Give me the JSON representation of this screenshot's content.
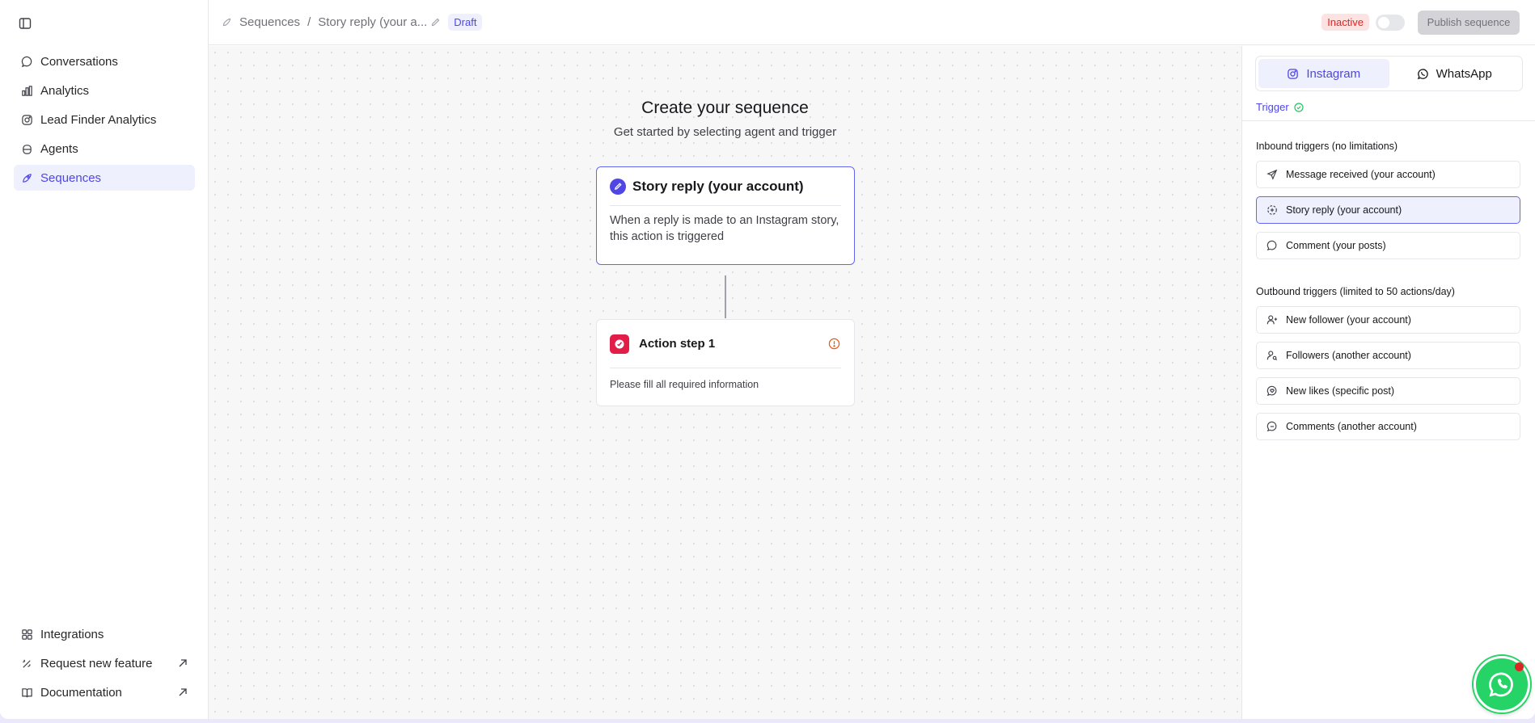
{
  "sidebar": {
    "toggle_icon": "sidebar-toggle-icon",
    "items": [
      {
        "label": "Conversations",
        "icon": "chat-icon"
      },
      {
        "label": "Analytics",
        "icon": "bar-chart-icon"
      },
      {
        "label": "Lead Finder Analytics",
        "icon": "instagram-icon"
      },
      {
        "label": "Agents",
        "icon": "bot-icon"
      },
      {
        "label": "Sequences",
        "icon": "rocket-icon",
        "active": true
      }
    ],
    "bottom": [
      {
        "label": "Integrations",
        "icon": "grid-icon"
      },
      {
        "label": "Request new feature",
        "icon": "wand-icon"
      },
      {
        "label": "Documentation",
        "icon": "book-icon"
      }
    ]
  },
  "header": {
    "crumb_root": "Sequences",
    "crumb_separator": "/",
    "crumb_current": "Story reply (your a...",
    "draft_badge": "Draft",
    "status_badge": "Inactive",
    "publish_label": "Publish sequence"
  },
  "canvas": {
    "title": "Create your sequence",
    "subtitle": "Get started by selecting agent and trigger",
    "trigger_card": {
      "title": "Story reply (your account)",
      "description": "When a reply is made to an Instagram story, this action is triggered"
    },
    "action_card": {
      "title": "Action step 1",
      "description": "Please fill all required information"
    }
  },
  "panel": {
    "tabs": [
      {
        "label": "Instagram",
        "icon": "instagram-icon",
        "active": true
      },
      {
        "label": "WhatsApp",
        "icon": "whatsapp-icon"
      }
    ],
    "trigger_label": "Trigger",
    "inbound_title": "Inbound triggers (no limitations)",
    "inbound": [
      {
        "label": "Message received (your account)",
        "icon": "send-icon"
      },
      {
        "label": "Story reply (your account)",
        "icon": "story-icon",
        "selected": true
      },
      {
        "label": "Comment (your posts)",
        "icon": "comment-icon"
      }
    ],
    "outbound_title": "Outbound triggers (limited to 50 actions/day)",
    "outbound": [
      {
        "label": "New follower (your account)",
        "icon": "user-plus-icon"
      },
      {
        "label": "Followers (another account)",
        "icon": "user-search-icon"
      },
      {
        "label": "New likes (specific post)",
        "icon": "heart-bubble-icon"
      },
      {
        "label": "Comments (another account)",
        "icon": "comment-icon"
      }
    ]
  },
  "colors": {
    "accent": "#4f46e5",
    "danger": "#dc2626",
    "whatsapp": "#25d366"
  }
}
